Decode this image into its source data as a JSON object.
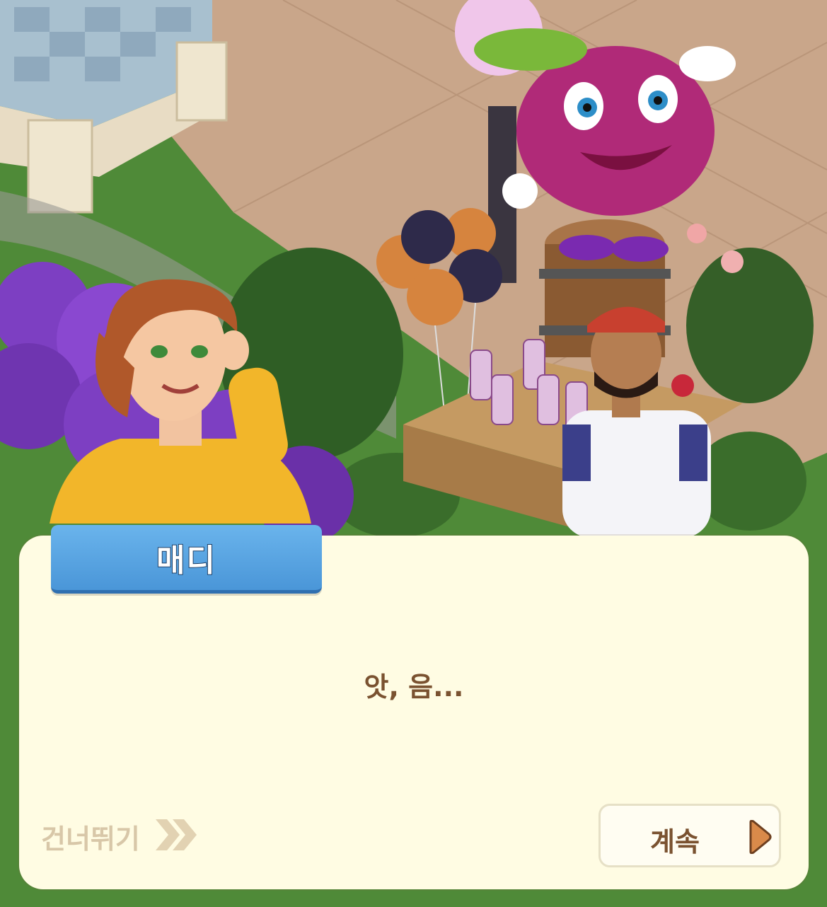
{
  "dialog": {
    "speaker": "매디",
    "text": "앗, 음...",
    "skip_label": "건너뛰기",
    "continue_label": "계속"
  },
  "icons": {
    "skip": "double-chevron-right-icon",
    "continue": "triangle-right-icon"
  },
  "colors": {
    "name_tab": "#5aa6e6",
    "dialog_bg": "#fffce3",
    "dialog_text": "#7a5230",
    "skip_text": "#d8c7a8",
    "continue_arrow": "#d98a4a"
  }
}
